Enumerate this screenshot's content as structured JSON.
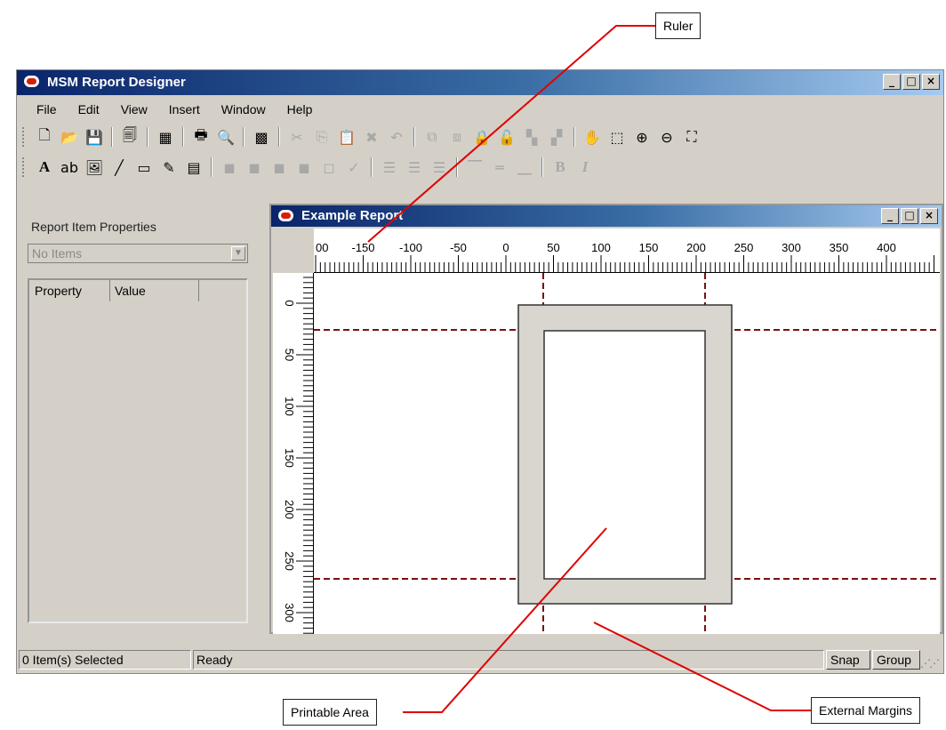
{
  "app": {
    "title": "MSM Report Designer",
    "window_controls": {
      "minimize": "_",
      "maximize": "□",
      "close": "×"
    }
  },
  "menu": [
    "File",
    "Edit",
    "View",
    "Insert",
    "Window",
    "Help"
  ],
  "toolbar1": [
    {
      "name": "new-file-icon",
      "glyph": "🗋"
    },
    {
      "name": "open-folder-icon",
      "glyph": "📂"
    },
    {
      "name": "save-icon",
      "glyph": "💾"
    },
    {
      "sep": true
    },
    {
      "name": "page-setup-icon",
      "glyph": "🗐"
    },
    {
      "sep": true
    },
    {
      "name": "color-palette-icon",
      "glyph": "▦"
    },
    {
      "sep": true
    },
    {
      "name": "print-icon",
      "glyph": "🖶"
    },
    {
      "name": "print-preview-icon",
      "glyph": "🔍"
    },
    {
      "sep": true
    },
    {
      "name": "grid-icon",
      "glyph": "▩"
    },
    {
      "sep": true
    },
    {
      "name": "cut-icon",
      "glyph": "✂",
      "disabled": true
    },
    {
      "name": "copy-icon",
      "glyph": "⎘",
      "disabled": true
    },
    {
      "name": "paste-icon",
      "glyph": "📋",
      "disabled": true
    },
    {
      "name": "delete-icon",
      "glyph": "✖",
      "disabled": true
    },
    {
      "name": "undo-icon",
      "glyph": "↶",
      "disabled": true
    },
    {
      "sep": true
    },
    {
      "name": "bring-front-icon",
      "glyph": "⧉",
      "disabled": true
    },
    {
      "name": "send-back-icon",
      "glyph": "⧈",
      "disabled": true
    },
    {
      "name": "lock-icon",
      "glyph": "🔒",
      "disabled": true
    },
    {
      "name": "unlock-icon",
      "glyph": "🔓",
      "disabled": true
    },
    {
      "name": "align-group-icon",
      "glyph": "▚",
      "disabled": true
    },
    {
      "name": "align-group-2-icon",
      "glyph": "▞",
      "disabled": true
    },
    {
      "sep": true
    },
    {
      "name": "pan-hand-icon",
      "glyph": "✋"
    },
    {
      "name": "zoom-area-icon",
      "glyph": "⬚"
    },
    {
      "name": "zoom-in-icon",
      "glyph": "⊕"
    },
    {
      "name": "zoom-out-icon",
      "glyph": "⊖"
    },
    {
      "name": "zoom-fit-icon",
      "glyph": "⛶"
    }
  ],
  "toolbar2": [
    {
      "name": "text-tool-icon",
      "glyph": "A",
      "text": true
    },
    {
      "name": "field-tool-icon",
      "glyph": "ab"
    },
    {
      "name": "image-tool-icon",
      "glyph": "🖼"
    },
    {
      "name": "line-tool-icon",
      "glyph": "╱"
    },
    {
      "name": "rectangle-tool-icon",
      "glyph": "▭"
    },
    {
      "name": "pen-tool-icon",
      "glyph": "✎"
    },
    {
      "name": "table-tool-icon",
      "glyph": "▤"
    },
    {
      "sep": true
    },
    {
      "name": "cube-icon-1",
      "glyph": "◼",
      "disabled": true
    },
    {
      "name": "cube-icon-2",
      "glyph": "◼",
      "disabled": true
    },
    {
      "name": "cube-icon-3",
      "glyph": "◼",
      "disabled": true
    },
    {
      "name": "cube-icon-4",
      "glyph": "◼",
      "disabled": true
    },
    {
      "name": "cube-icon-5",
      "glyph": "◻",
      "disabled": true
    },
    {
      "name": "format-check-icon",
      "glyph": "✓",
      "disabled": true
    },
    {
      "sep": true
    },
    {
      "name": "align-left-icon",
      "glyph": "☰",
      "disabled": true
    },
    {
      "name": "align-center-icon",
      "glyph": "☰",
      "disabled": true
    },
    {
      "name": "align-right-icon",
      "glyph": "☰",
      "disabled": true
    },
    {
      "sep": true
    },
    {
      "name": "valign-top-icon",
      "glyph": "⎺",
      "disabled": true
    },
    {
      "name": "valign-middle-icon",
      "glyph": "═",
      "disabled": true
    },
    {
      "name": "valign-bottom-icon",
      "glyph": "⎽",
      "disabled": true
    },
    {
      "sep": true
    },
    {
      "name": "bold-icon",
      "glyph": "B",
      "text": true,
      "disabled": true
    },
    {
      "name": "italic-icon",
      "glyph": "I",
      "text": true,
      "disabled": true
    }
  ],
  "panel": {
    "title": "Report Item Properties",
    "combo_value": "No Items",
    "columns": [
      "Property",
      "Value"
    ]
  },
  "report": {
    "title": "Example Report",
    "ruler_h_labels": [
      "00",
      "-150",
      "-100",
      "-50",
      "0",
      "50",
      "100",
      "150",
      "200",
      "250",
      "300",
      "350",
      "400"
    ],
    "ruler_v_labels": [
      "0",
      "50",
      "100",
      "150",
      "200",
      "250",
      "300"
    ]
  },
  "status": {
    "selected": "0 Item(s) Selected",
    "state": "Ready",
    "snap": "Snap",
    "group": "Group"
  },
  "callouts": {
    "ruler": "Ruler",
    "printable_area": "Printable Area",
    "external_margins": "External Margins"
  },
  "colors": {
    "margin_line": "#7a1010",
    "callout_line": "#e00000",
    "page_frame": "#d9d6d0"
  }
}
